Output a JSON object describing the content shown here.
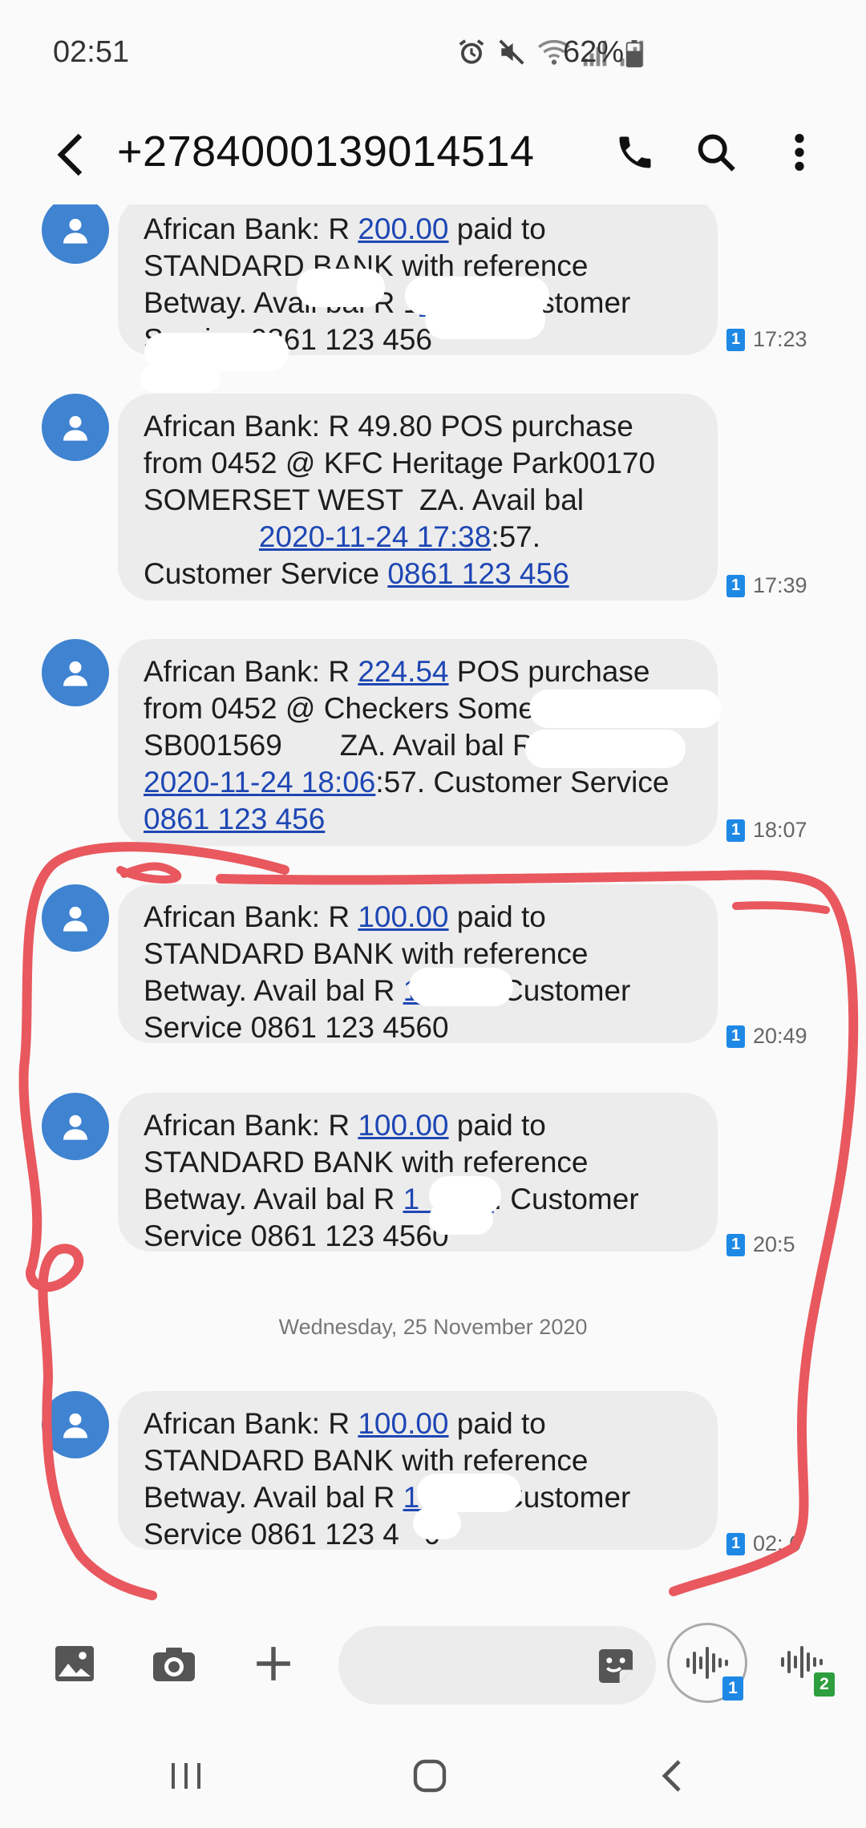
{
  "status_bar": {
    "time": "02:51",
    "battery": "62%",
    "icons": [
      "alarm-icon",
      "mute-icon",
      "wifi-icon",
      "signal-icon",
      "signal-icon",
      "battery-icon"
    ]
  },
  "header": {
    "title": "+2784000139014514",
    "icons": [
      "back-icon",
      "phone-icon",
      "search-icon",
      "more-vert-icon"
    ]
  },
  "messages": [
    {
      "parts": [
        {
          "t": "African Bank: R "
        },
        {
          "t": "200.00",
          "link": true
        },
        {
          "t": " paid to\nSTANDARD BANK with reference\nBetway. Avail bal R 1"
        },
        {
          "t": "      8",
          "link": true
        },
        {
          "t": ". Customer\nService 0861 123 456"
        }
      ],
      "sim": "1",
      "time": "17:23"
    },
    {
      "parts": [
        {
          "t": "African Bank: R 49.80 POS purchase\nfrom 0452 @ KFC Heritage Park00170\nSOMERSET WEST  ZA. Avail bal\n              "
        },
        {
          "t": "2020-11-24 17:38",
          "link": true
        },
        {
          "t": ":57.\nCustomer Service "
        },
        {
          "t": "0861 123 456",
          "link": true
        }
      ],
      "sim": "1",
      "time": "17:39"
    },
    {
      "parts": [
        {
          "t": "African Bank: R "
        },
        {
          "t": "224.54",
          "link": true
        },
        {
          "t": " POS purchase\nfrom 0452 @ Checkers Somerset West\nSB001569       ZA. Avail bal R 1566\n"
        },
        {
          "t": "2020-11-24 18:06",
          "link": true
        },
        {
          "t": ":57. Customer Service\n"
        },
        {
          "t": "0861 123 456",
          "link": true
        }
      ],
      "sim": "1",
      "time": "18:07"
    },
    {
      "parts": [
        {
          "t": "African Bank: R "
        },
        {
          "t": "100.00",
          "link": true
        },
        {
          "t": " paid to\nSTANDARD BANK with reference\nBetway. Avail bal R "
        },
        {
          "t": "1      4",
          "link": true
        },
        {
          "t": ". Customer\nService 0861 123 4560"
        }
      ],
      "sim": "1",
      "time": "20:49"
    },
    {
      "parts": [
        {
          "t": "African Bank: R "
        },
        {
          "t": "100.00",
          "link": true
        },
        {
          "t": " paid to\nSTANDARD BANK with reference\nBetway. Avail bal R "
        },
        {
          "t": "1     54",
          "link": true
        },
        {
          "t": ". Customer\nService 0861 123 4560"
        }
      ],
      "sim": "1",
      "time": "20:5"
    },
    {
      "parts": [
        {
          "t": "African Bank: R "
        },
        {
          "t": "100.00",
          "link": true
        },
        {
          "t": " paid to\nSTANDARD BANK with reference\nBetway. Avail bal R "
        },
        {
          "t": "1      4",
          "link": true
        },
        {
          "t": ". Customer\nService 0861 123 4   0"
        }
      ],
      "sim": "1",
      "time": "02:  6"
    }
  ],
  "date_separator": "Wednesday, 25 November 2020",
  "composer": {
    "placeholder": "",
    "icons": [
      "gallery-icon",
      "camera-icon",
      "add-icon",
      "sticker-icon",
      "voice-sim1-icon",
      "voice-sim2-icon"
    ],
    "sim1_badge": "1",
    "sim2_badge": "2"
  },
  "navbar": {
    "icons": [
      "recents-icon",
      "home-icon",
      "back-nav-icon"
    ]
  },
  "colors": {
    "avatar": "#3f83d1",
    "bubble": "#ececec",
    "link": "#1e47b4",
    "sim_badge": "#1e88e5",
    "annotation": "#e8585e"
  }
}
